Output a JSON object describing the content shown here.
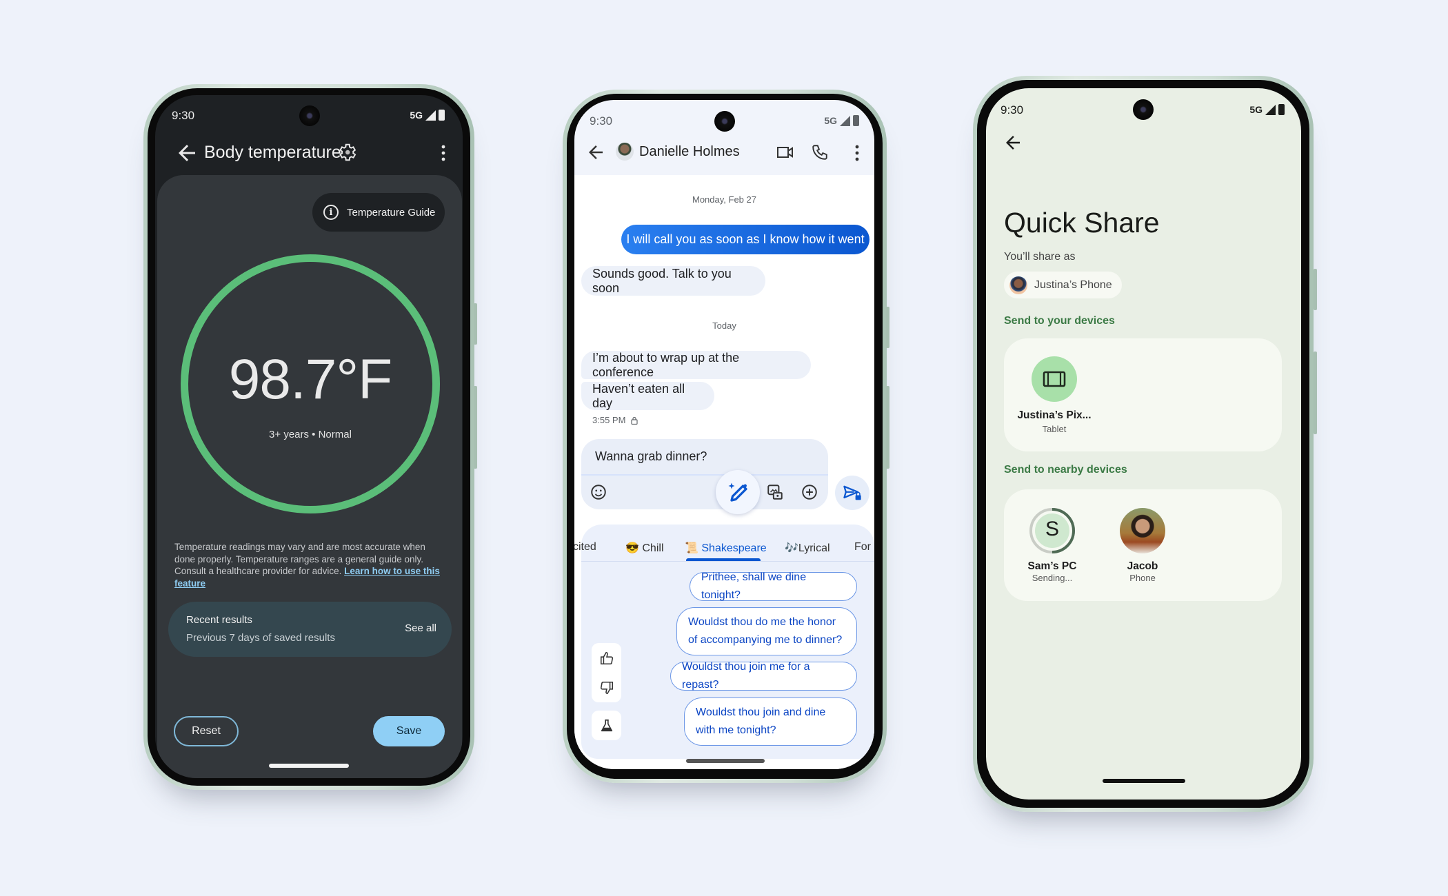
{
  "colors": {
    "background": "#eef2fa",
    "temp_ring": "#5bbe79",
    "save_button": "#8fcff5",
    "sent_bubble": "#0b57d0",
    "suggestion_text": "#0b45c4",
    "quick_share_section": "#3b7a45",
    "tablet_circle": "#a8e0a9"
  },
  "phone1": {
    "status": {
      "time": "9:30",
      "network": "5G"
    },
    "header": {
      "title": "Body temperature",
      "back_icon": "arrow-left",
      "settings_icon": "gear",
      "more_icon": "more-vert"
    },
    "guide_button": {
      "label": "Temperature Guide",
      "icon": "info"
    },
    "reading": {
      "value": "98.7°F",
      "subtitle": "3+ years • Normal"
    },
    "disclaimer": {
      "text": "Temperature readings may vary and are most accurate when done properly. Temperature ranges are a general guide only. Consult a healthcare provider for advice.",
      "link": "Learn how to use this feature"
    },
    "recent": {
      "title": "Recent results",
      "subtitle": "Previous 7 days of saved results",
      "action": "See all"
    },
    "buttons": {
      "reset": "Reset",
      "save": "Save"
    }
  },
  "phone2": {
    "status": {
      "time": "9:30",
      "network": "5G"
    },
    "header": {
      "contact_name": "Danielle Holmes",
      "back_icon": "arrow-left",
      "video_icon": "videocam",
      "call_icon": "phone",
      "more_icon": "more-vert"
    },
    "date_labels": {
      "first": "Monday, Feb 27",
      "second": "Today"
    },
    "messages": [
      {
        "direction": "out",
        "text": "I will call you as soon as I know how it went"
      },
      {
        "direction": "in",
        "text": "Sounds good. Talk to you soon"
      },
      {
        "direction": "in",
        "text": "I’m about to wrap up at the conference"
      },
      {
        "direction": "in",
        "text": "Haven’t eaten all day"
      }
    ],
    "timestamp": "3:55 PM",
    "compose": {
      "value": "Wanna grab dinner?",
      "emoji_icon": "emoji",
      "magic_icon": "magic-compose",
      "gallery_icon": "gallery",
      "add_icon": "add-circle",
      "send_icon": "send-lock"
    },
    "tabs": [
      {
        "emoji": "",
        "label": "cited"
      },
      {
        "emoji": "😎",
        "label": "Chill"
      },
      {
        "emoji": "📜",
        "label": "Shakespeare",
        "active": true
      },
      {
        "emoji": "🎶",
        "label": "Lyrical"
      },
      {
        "emoji": "",
        "label": "For"
      }
    ],
    "suggestions": [
      "Prithee, shall we dine tonight?",
      "Wouldst thou do me the honor of accompanying me to dinner?",
      "Wouldst thou join me for a repast?",
      "Wouldst thou join and dine with me tonight?"
    ],
    "feedback_icons": [
      "thumb-up",
      "thumb-down",
      "flask"
    ]
  },
  "phone3": {
    "status": {
      "time": "9:30",
      "network": "5G"
    },
    "title": "Quick Share",
    "share_as_label": "You’ll share as",
    "share_as_device": "Justina’s Phone",
    "section_own": "Send to your devices",
    "own_devices": [
      {
        "name": "Justina’s Pix...",
        "type": "Tablet"
      }
    ],
    "section_nearby": "Send to nearby devices",
    "nearby_devices": [
      {
        "name": "Sam’s PC",
        "status": "Sending...",
        "initial": "S",
        "progress": 0.5
      },
      {
        "name": "Jacob",
        "status": "Phone"
      }
    ]
  }
}
